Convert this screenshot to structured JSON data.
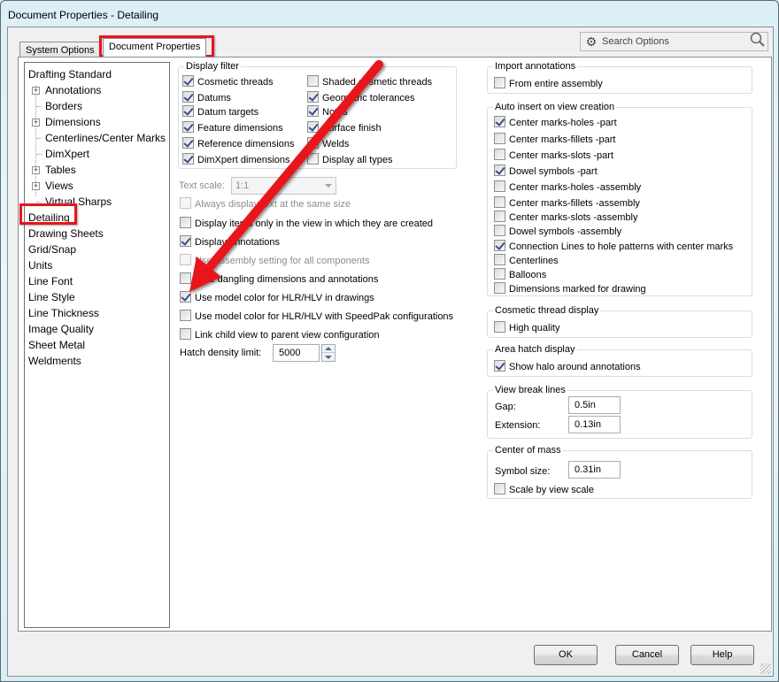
{
  "window": {
    "title": "Document Properties - Detailing"
  },
  "tabs": [
    {
      "label": "System Options",
      "active": false
    },
    {
      "label": "Document Properties",
      "active": true
    }
  ],
  "search": {
    "placeholder": "Search Options",
    "gear_icon": "gear-icon",
    "search_icon": "search-icon"
  },
  "tree": {
    "items": [
      {
        "label": "Drafting Standard",
        "level": 0,
        "expandable": false
      },
      {
        "label": "Annotations",
        "level": 1,
        "expandable": true
      },
      {
        "label": "Borders",
        "level": 1,
        "expandable": false
      },
      {
        "label": "Dimensions",
        "level": 1,
        "expandable": true
      },
      {
        "label": "Centerlines/Center Marks",
        "level": 1,
        "expandable": false
      },
      {
        "label": "DimXpert",
        "level": 1,
        "expandable": false
      },
      {
        "label": "Tables",
        "level": 1,
        "expandable": true
      },
      {
        "label": "Views",
        "level": 1,
        "expandable": true
      },
      {
        "label": "Virtual Sharps",
        "level": 1,
        "expandable": false
      },
      {
        "label": "Detailing",
        "level": 0,
        "selected": true
      },
      {
        "label": "Drawing Sheets",
        "level": 0
      },
      {
        "label": "Grid/Snap",
        "level": 0
      },
      {
        "label": "Units",
        "level": 0
      },
      {
        "label": "Line Font",
        "level": 0
      },
      {
        "label": "Line Style",
        "level": 0
      },
      {
        "label": "Line Thickness",
        "level": 0
      },
      {
        "label": "Image Quality",
        "level": 0
      },
      {
        "label": "Sheet Metal",
        "level": 0
      },
      {
        "label": "Weldments",
        "level": 0
      }
    ]
  },
  "display_filter": {
    "title": "Display filter",
    "left": [
      {
        "label": "Cosmetic threads",
        "checked": true
      },
      {
        "label": "Datums",
        "checked": true
      },
      {
        "label": "Datum targets",
        "checked": true
      },
      {
        "label": "Feature dimensions",
        "checked": true
      },
      {
        "label": "Reference dimensions",
        "checked": true
      },
      {
        "label": "DimXpert dimensions",
        "checked": true
      }
    ],
    "right": [
      {
        "label": "Shaded cosmetic threads",
        "checked": false
      },
      {
        "label": "Geometric tolerances",
        "checked": true
      },
      {
        "label": "Notes",
        "checked": true
      },
      {
        "label": "Surface finish",
        "checked": true
      },
      {
        "label": "Welds",
        "checked": false
      },
      {
        "label": "Display all types",
        "checked": false
      }
    ]
  },
  "text_scale": {
    "label": "Text scale:",
    "value": "1:1",
    "disabled": true
  },
  "options": [
    {
      "label": "Always display text at the same size",
      "checked": false,
      "disabled": true
    },
    {
      "label": "Display items only in the view in which they are created",
      "checked": false
    },
    {
      "label": "Display annotations",
      "checked": true
    },
    {
      "label": "Use assembly setting for all components",
      "checked": false,
      "disabled": true
    },
    {
      "label": "Hide dangling dimensions and annotations",
      "checked": false
    },
    {
      "label": "Use model color for HLR/HLV in drawings",
      "checked": true
    },
    {
      "label": "Use model color for HLR/HLV with SpeedPak configurations",
      "checked": false
    },
    {
      "label": "Link child view to parent view configuration",
      "checked": false
    }
  ],
  "hatch_density": {
    "label": "Hatch density limit:",
    "value": "5000"
  },
  "import_annotations": {
    "title": "Import annotations",
    "items": [
      {
        "label": "From entire assembly",
        "checked": false
      }
    ]
  },
  "auto_insert": {
    "title": "Auto insert on view creation",
    "items": [
      {
        "label": "Center marks-holes -part",
        "checked": true
      },
      {
        "label": "Center marks-fillets -part",
        "checked": false
      },
      {
        "label": "Center marks-slots  -part",
        "checked": false
      },
      {
        "label": "Dowel symbols -part",
        "checked": true
      },
      {
        "label": "Center marks-holes -assembly",
        "checked": false
      },
      {
        "label": "Center marks-fillets -assembly",
        "checked": false
      },
      {
        "label": "Center marks-slots  -assembly",
        "checked": false
      },
      {
        "label": "Dowel symbols -assembly",
        "checked": false
      },
      {
        "label": "Connection Lines to hole patterns with center marks",
        "checked": true
      },
      {
        "label": "Centerlines",
        "checked": false
      },
      {
        "label": "Balloons",
        "checked": false
      },
      {
        "label": "Dimensions marked for drawing",
        "checked": false
      }
    ]
  },
  "cosmetic_thread_display": {
    "title": "Cosmetic thread display",
    "items": [
      {
        "label": "High quality",
        "checked": false
      }
    ]
  },
  "area_hatch_display": {
    "title": "Area hatch display",
    "items": [
      {
        "label": "Show halo around annotations",
        "checked": true
      }
    ]
  },
  "view_break_lines": {
    "title": "View break lines",
    "gap_label": "Gap:",
    "gap_value": "0.5in",
    "extension_label": "Extension:",
    "extension_value": "0.13in"
  },
  "center_of_mass": {
    "title": "Center of mass",
    "symbol_size_label": "Symbol size:",
    "symbol_size_value": "0.31in",
    "items": [
      {
        "label": "Scale by view scale",
        "checked": false
      }
    ]
  },
  "buttons": {
    "ok": "OK",
    "cancel": "Cancel",
    "help": "Help"
  },
  "annotation": {
    "highlight_color": "#e8141b",
    "arrow_color": "#e8141b"
  }
}
